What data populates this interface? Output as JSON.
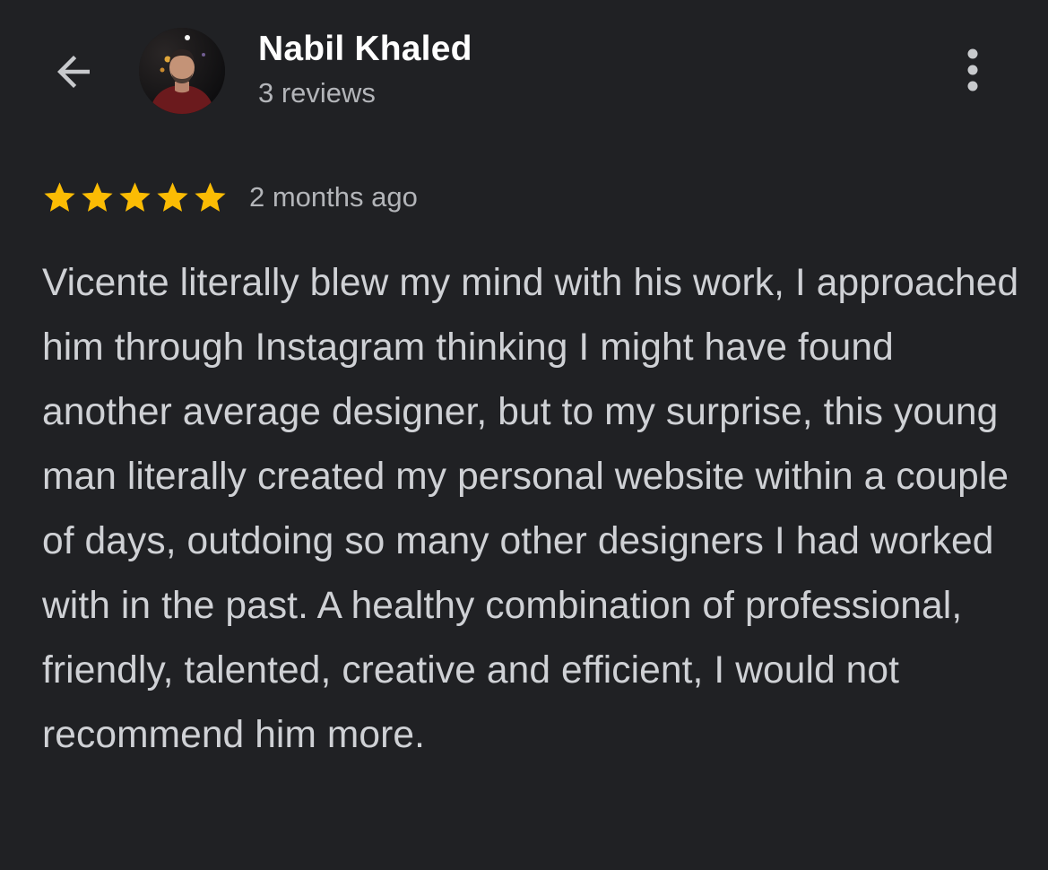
{
  "header": {
    "back_icon": "arrow-left-icon",
    "avatar_icon": "reviewer-profile-photo",
    "reviewer_name": "Nabil Khaled",
    "review_count": "3 reviews",
    "more_icon": "more-vert-icon"
  },
  "review": {
    "rating": 5,
    "rating_max": 5,
    "star_icon": "star-icon",
    "star_color": "#fbbc04",
    "time": "2 months ago",
    "text": "Vicente literally blew my mind with his work, I approached him through Instagram thinking I might have found another average designer, but to my surprise, this young man literally created my personal website within a couple of days, outdoing so many other designers I had worked with in the past. A healthy combination of professional, friendly, talented, creative and efficient, I would not recommend him more."
  },
  "theme": {
    "background": "#202124",
    "name_color": "#ffffff",
    "secondary_text": "#b3b5b9",
    "body_text": "#cfd1d5"
  }
}
